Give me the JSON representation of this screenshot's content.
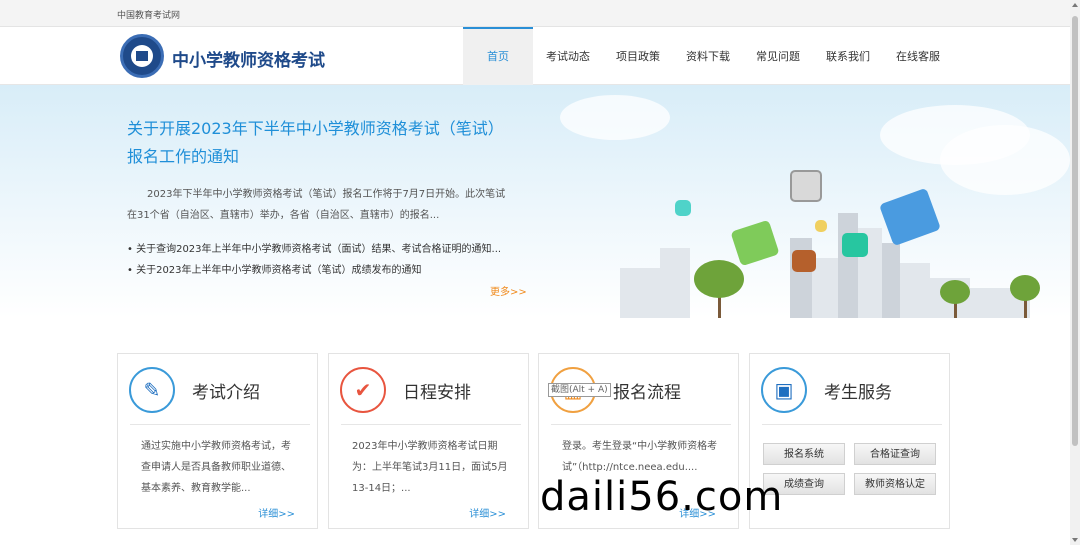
{
  "topbar": {
    "site_name": "中国教育考试网"
  },
  "header": {
    "logo_text": "中小学教师资格考试"
  },
  "nav": {
    "items": [
      {
        "label": "首页"
      },
      {
        "label": "考试动态"
      },
      {
        "label": "项目政策"
      },
      {
        "label": "资料下载"
      },
      {
        "label": "常见问题"
      },
      {
        "label": "联系我们"
      },
      {
        "label": "在线客服"
      }
    ],
    "active_index": 0
  },
  "banner": {
    "title": "关于开展2023年下半年中小学教师资格考试（笔试）报名工作的通知",
    "description": "2023年下半年中小学教师资格考试（笔试）报名工作将于7月7日开始。此次笔试在31个省（自治区、直辖市）举办，各省（自治区、直辖市）的报名...",
    "news": [
      "关于查询2023年上半年中小学教师资格考试（面试）结果、考试合格证明的通知...",
      "关于2023年上半年中小学教师资格考试（笔试）成绩发布的通知"
    ],
    "more_label": "更多>>"
  },
  "cards": [
    {
      "title": "考试介绍",
      "icon": "document-edit-icon",
      "body": "通过实施中小学教师资格考试，考查申请人是否具备教师职业道德、基本素养、教育教学能...",
      "more_label": "详细>>"
    },
    {
      "title": "日程安排",
      "icon": "checkmark-icon",
      "body": "2023年中小学教师资格考试日期为：上半年笔试3月11日，面试5月13-14日；...",
      "more_label": "详细>>"
    },
    {
      "title": "报名流程",
      "icon": "calendar-icon",
      "body": "登录。考生登录“中小学教师资格考试”（http://ntce.neea.edu....",
      "more_label": "详细>>"
    },
    {
      "title": "考生服务",
      "icon": "contact-book-icon",
      "buttons": [
        "报名系统",
        "合格证查询",
        "成绩查询",
        "教师资格认定"
      ]
    }
  ],
  "overlay": {
    "shortcut_tip": "截图(Alt + A)",
    "watermark": "daili56.com"
  },
  "colors": {
    "accent": "#2a8fd6",
    "logo": "#1f4a8a",
    "more": "#f08a1c"
  }
}
